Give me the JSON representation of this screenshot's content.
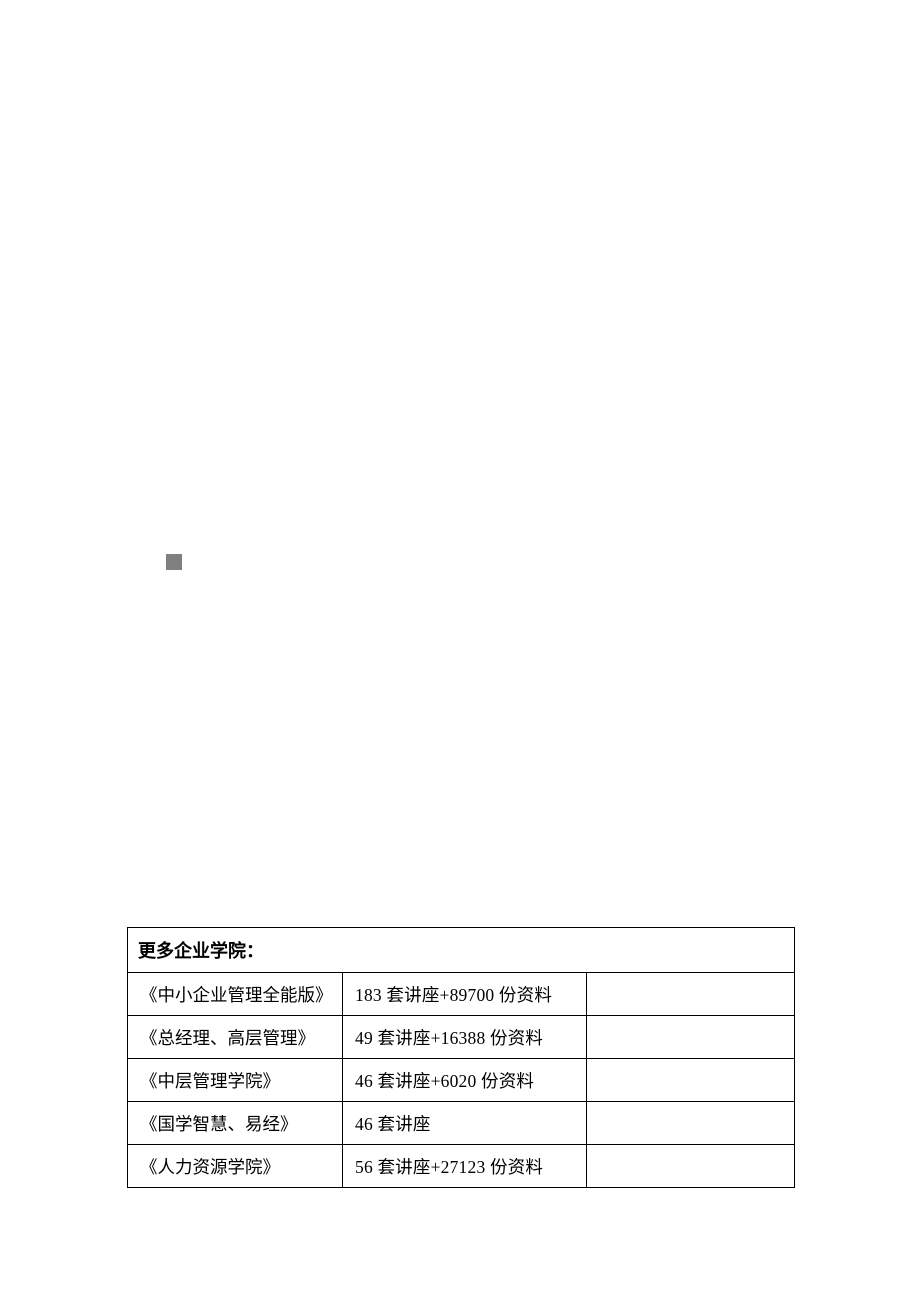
{
  "table": {
    "header": "更多企业学院：",
    "rows": [
      {
        "name": "《中小企业管理全能版》",
        "desc": "183 套讲座+89700 份资料"
      },
      {
        "name": "《总经理、高层管理》",
        "desc": "49 套讲座+16388 份资料"
      },
      {
        "name": "《中层管理学院》",
        "desc": "46 套讲座+6020 份资料"
      },
      {
        "name": "《国学智慧、易经》",
        "desc": "46 套讲座"
      },
      {
        "name": "《人力资源学院》",
        "desc": "56 套讲座+27123 份资料"
      }
    ]
  }
}
